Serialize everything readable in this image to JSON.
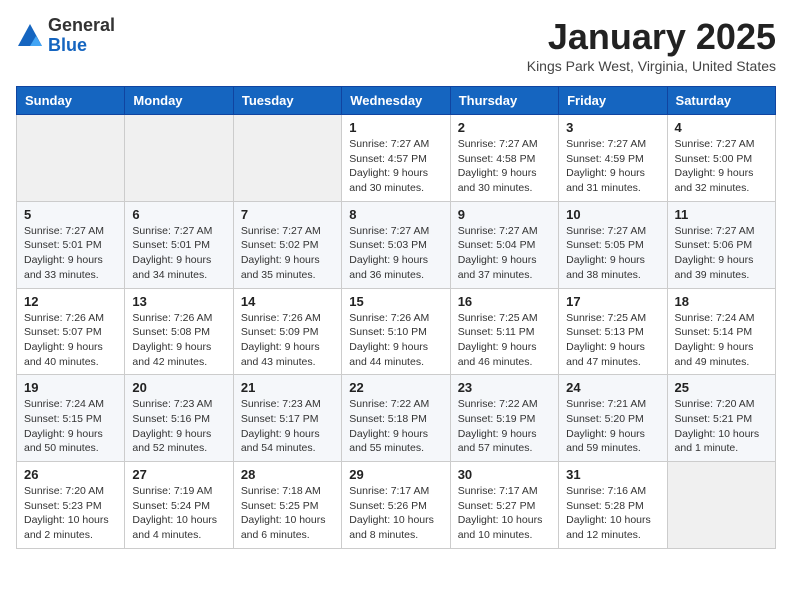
{
  "logo": {
    "general": "General",
    "blue": "Blue"
  },
  "title": "January 2025",
  "location": "Kings Park West, Virginia, United States",
  "columns": [
    "Sunday",
    "Monday",
    "Tuesday",
    "Wednesday",
    "Thursday",
    "Friday",
    "Saturday"
  ],
  "weeks": [
    [
      {
        "day": "",
        "info": ""
      },
      {
        "day": "",
        "info": ""
      },
      {
        "day": "",
        "info": ""
      },
      {
        "day": "1",
        "info": "Sunrise: 7:27 AM\nSunset: 4:57 PM\nDaylight: 9 hours\nand 30 minutes."
      },
      {
        "day": "2",
        "info": "Sunrise: 7:27 AM\nSunset: 4:58 PM\nDaylight: 9 hours\nand 30 minutes."
      },
      {
        "day": "3",
        "info": "Sunrise: 7:27 AM\nSunset: 4:59 PM\nDaylight: 9 hours\nand 31 minutes."
      },
      {
        "day": "4",
        "info": "Sunrise: 7:27 AM\nSunset: 5:00 PM\nDaylight: 9 hours\nand 32 minutes."
      }
    ],
    [
      {
        "day": "5",
        "info": "Sunrise: 7:27 AM\nSunset: 5:01 PM\nDaylight: 9 hours\nand 33 minutes."
      },
      {
        "day": "6",
        "info": "Sunrise: 7:27 AM\nSunset: 5:01 PM\nDaylight: 9 hours\nand 34 minutes."
      },
      {
        "day": "7",
        "info": "Sunrise: 7:27 AM\nSunset: 5:02 PM\nDaylight: 9 hours\nand 35 minutes."
      },
      {
        "day": "8",
        "info": "Sunrise: 7:27 AM\nSunset: 5:03 PM\nDaylight: 9 hours\nand 36 minutes."
      },
      {
        "day": "9",
        "info": "Sunrise: 7:27 AM\nSunset: 5:04 PM\nDaylight: 9 hours\nand 37 minutes."
      },
      {
        "day": "10",
        "info": "Sunrise: 7:27 AM\nSunset: 5:05 PM\nDaylight: 9 hours\nand 38 minutes."
      },
      {
        "day": "11",
        "info": "Sunrise: 7:27 AM\nSunset: 5:06 PM\nDaylight: 9 hours\nand 39 minutes."
      }
    ],
    [
      {
        "day": "12",
        "info": "Sunrise: 7:26 AM\nSunset: 5:07 PM\nDaylight: 9 hours\nand 40 minutes."
      },
      {
        "day": "13",
        "info": "Sunrise: 7:26 AM\nSunset: 5:08 PM\nDaylight: 9 hours\nand 42 minutes."
      },
      {
        "day": "14",
        "info": "Sunrise: 7:26 AM\nSunset: 5:09 PM\nDaylight: 9 hours\nand 43 minutes."
      },
      {
        "day": "15",
        "info": "Sunrise: 7:26 AM\nSunset: 5:10 PM\nDaylight: 9 hours\nand 44 minutes."
      },
      {
        "day": "16",
        "info": "Sunrise: 7:25 AM\nSunset: 5:11 PM\nDaylight: 9 hours\nand 46 minutes."
      },
      {
        "day": "17",
        "info": "Sunrise: 7:25 AM\nSunset: 5:13 PM\nDaylight: 9 hours\nand 47 minutes."
      },
      {
        "day": "18",
        "info": "Sunrise: 7:24 AM\nSunset: 5:14 PM\nDaylight: 9 hours\nand 49 minutes."
      }
    ],
    [
      {
        "day": "19",
        "info": "Sunrise: 7:24 AM\nSunset: 5:15 PM\nDaylight: 9 hours\nand 50 minutes."
      },
      {
        "day": "20",
        "info": "Sunrise: 7:23 AM\nSunset: 5:16 PM\nDaylight: 9 hours\nand 52 minutes."
      },
      {
        "day": "21",
        "info": "Sunrise: 7:23 AM\nSunset: 5:17 PM\nDaylight: 9 hours\nand 54 minutes."
      },
      {
        "day": "22",
        "info": "Sunrise: 7:22 AM\nSunset: 5:18 PM\nDaylight: 9 hours\nand 55 minutes."
      },
      {
        "day": "23",
        "info": "Sunrise: 7:22 AM\nSunset: 5:19 PM\nDaylight: 9 hours\nand 57 minutes."
      },
      {
        "day": "24",
        "info": "Sunrise: 7:21 AM\nSunset: 5:20 PM\nDaylight: 9 hours\nand 59 minutes."
      },
      {
        "day": "25",
        "info": "Sunrise: 7:20 AM\nSunset: 5:21 PM\nDaylight: 10 hours\nand 1 minute."
      }
    ],
    [
      {
        "day": "26",
        "info": "Sunrise: 7:20 AM\nSunset: 5:23 PM\nDaylight: 10 hours\nand 2 minutes."
      },
      {
        "day": "27",
        "info": "Sunrise: 7:19 AM\nSunset: 5:24 PM\nDaylight: 10 hours\nand 4 minutes."
      },
      {
        "day": "28",
        "info": "Sunrise: 7:18 AM\nSunset: 5:25 PM\nDaylight: 10 hours\nand 6 minutes."
      },
      {
        "day": "29",
        "info": "Sunrise: 7:17 AM\nSunset: 5:26 PM\nDaylight: 10 hours\nand 8 minutes."
      },
      {
        "day": "30",
        "info": "Sunrise: 7:17 AM\nSunset: 5:27 PM\nDaylight: 10 hours\nand 10 minutes."
      },
      {
        "day": "31",
        "info": "Sunrise: 7:16 AM\nSunset: 5:28 PM\nDaylight: 10 hours\nand 12 minutes."
      },
      {
        "day": "",
        "info": ""
      }
    ]
  ]
}
